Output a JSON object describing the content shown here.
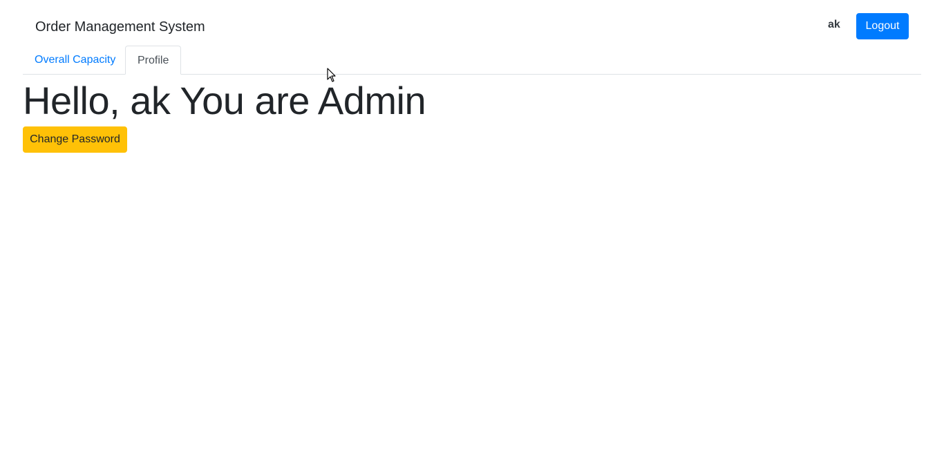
{
  "navbar": {
    "brand": "Order Management System",
    "user_name": "ak",
    "logout_label": "Logout"
  },
  "tabs": [
    {
      "label": "Overall Capacity",
      "active": false
    },
    {
      "label": "Profile",
      "active": true
    }
  ],
  "profile": {
    "greeting": "Hello, ak You are Admin",
    "change_password_label": "Change Password"
  },
  "colors": {
    "primary": "#007bff",
    "warning": "#ffc107",
    "text": "#212529",
    "border": "#dee2e6"
  },
  "icons": {
    "cursor": "mouse-pointer-icon"
  }
}
